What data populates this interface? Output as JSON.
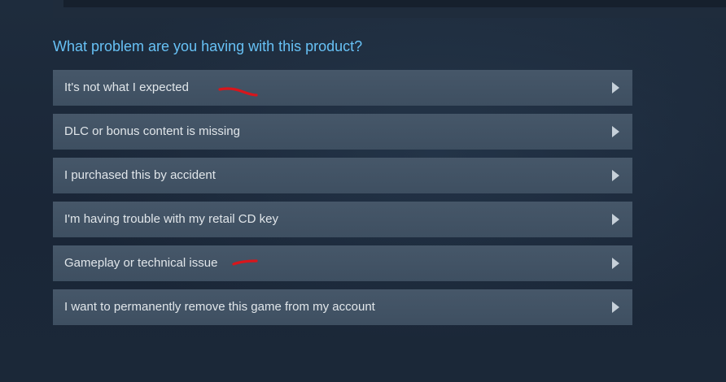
{
  "prompt": "What problem are you having with this product?",
  "options": [
    {
      "label": "It's not what I expected"
    },
    {
      "label": "DLC or bonus content is missing"
    },
    {
      "label": "I purchased this by accident"
    },
    {
      "label": "I'm having trouble with my retail CD key"
    },
    {
      "label": "Gameplay or technical issue"
    },
    {
      "label": "I want to permanently remove this game from my account"
    }
  ],
  "colors": {
    "background": "#1b2838",
    "prompt_text": "#67c1f5",
    "option_background": "#435466",
    "option_text": "#e1e6ea",
    "annotation_mark": "#d8161c"
  },
  "icons": {
    "option_arrow": "chevron-right-icon"
  }
}
